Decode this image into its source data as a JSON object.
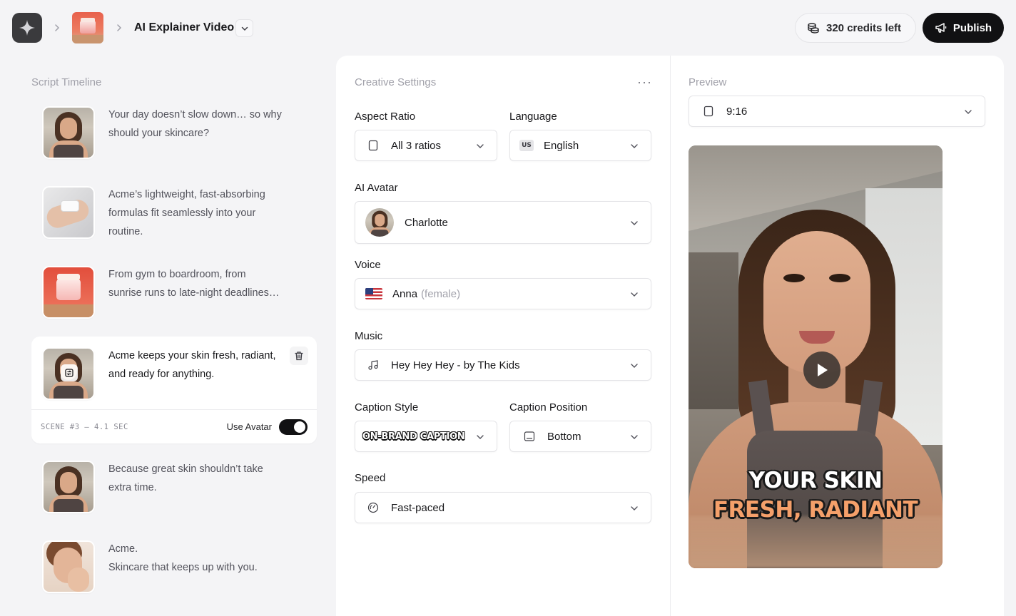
{
  "header": {
    "project_title": "AI Explainer Video",
    "credits_label": "320 credits left",
    "publish_label": "Publish"
  },
  "timeline": {
    "title": "Script Timeline",
    "scenes": [
      {
        "text": "Your day doesn’t slow down… so why should your skincare?"
      },
      {
        "text": "Acme’s lightweight, fast-absorbing formulas fit seamlessly into your routine."
      },
      {
        "text": "From gym to boardroom, from sunrise runs to late-night deadlines…"
      },
      {
        "text": "Acme keeps your skin fresh, radiant, and ready for anything.",
        "meta": "SCENE #3 – 4.1 SEC",
        "toggle_label": "Use Avatar",
        "use_avatar": true
      },
      {
        "text": "Because great skin shouldn’t take extra time."
      },
      {
        "text_line1": "Acme.",
        "text_line2": "Skincare that keeps up with you."
      }
    ]
  },
  "settings": {
    "title": "Creative Settings",
    "aspect_ratio": {
      "label": "Aspect Ratio",
      "value": "All 3 ratios"
    },
    "language": {
      "label": "Language",
      "badge": "US",
      "value": "English"
    },
    "avatar": {
      "label": "AI Avatar",
      "value": "Charlotte"
    },
    "voice": {
      "label": "Voice",
      "value": "Anna",
      "detail": "(female)"
    },
    "music": {
      "label": "Music",
      "value": "Hey Hey Hey - by The Kids"
    },
    "caption_style": {
      "label": "Caption Style",
      "value": "ON-BRAND CAPTION"
    },
    "caption_position": {
      "label": "Caption Position",
      "value": "Bottom"
    },
    "speed": {
      "label": "Speed",
      "value": "Fast-paced"
    }
  },
  "preview": {
    "title": "Preview",
    "ratio": "9:16",
    "caption_line1": "YOUR SKIN",
    "caption_line2": "FRESH, RADIANT",
    "caption_color1": "#ffffff",
    "caption_color2": "#f5a06a"
  },
  "colors": {
    "accent_dark": "#111113",
    "background": "#f4f4f6",
    "panel": "#ffffff"
  }
}
